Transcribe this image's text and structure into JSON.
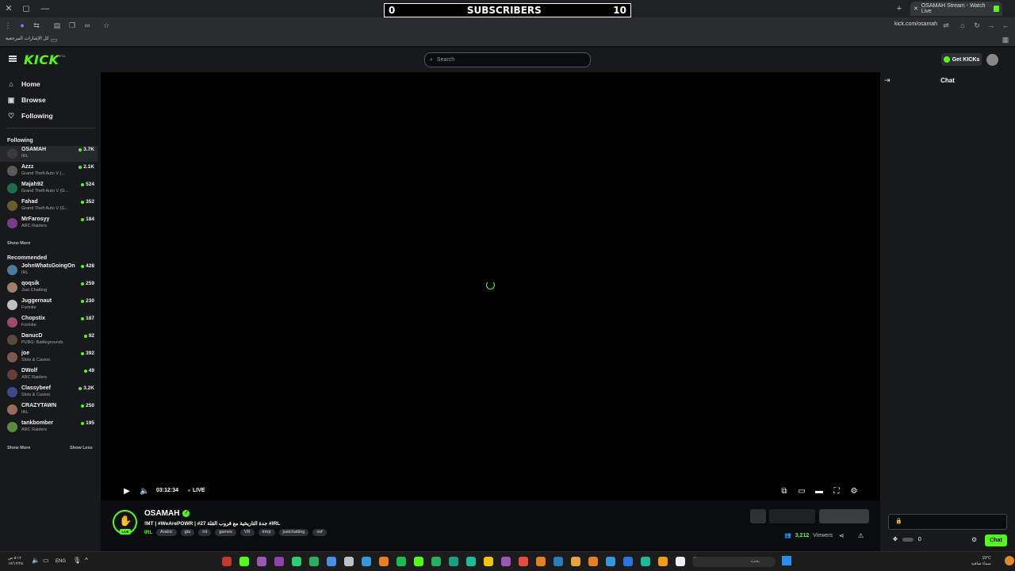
{
  "overlay": {
    "left_count": "0",
    "label": "SUBSCRIBERS",
    "right_count": "10"
  },
  "browser": {
    "tab_title": "OSAMAH Stream - Watch Live",
    "url": "kick.com/osamah",
    "bookmarks_label": "كل الإشارات المرجعية"
  },
  "header": {
    "logo": "KICK",
    "logo_beta": "BETA",
    "search_placeholder": "Search",
    "get_kicks": "Get KICKs"
  },
  "nav": [
    {
      "label": "Home",
      "icon": "home-icon"
    },
    {
      "label": "Browse",
      "icon": "compass-icon"
    },
    {
      "label": "Following",
      "icon": "heart-icon"
    }
  ],
  "following": {
    "title": "Following",
    "channels": [
      {
        "name": "OSAMAH",
        "category": "IRL",
        "viewers": "3.7K",
        "color": "#3a3a3a"
      },
      {
        "name": "Azzz",
        "category": "Grand Theft Auto V (...",
        "viewers": "2.1K",
        "color": "#5a5a5a"
      },
      {
        "name": "Majah92",
        "category": "Grand Theft Auto V (G...",
        "viewers": "524",
        "color": "#1f6b4a"
      },
      {
        "name": "Fahad",
        "category": "Grand Theft Auto V (G...",
        "viewers": "352",
        "color": "#6b5a2a"
      },
      {
        "name": "MrFarosyy",
        "category": "ARC Raiders",
        "viewers": "184",
        "color": "#7a3a8a"
      }
    ],
    "show_more": "Show More"
  },
  "recommended": {
    "title": "Recommended",
    "channels": [
      {
        "name": "JohnWhatsGoingOn",
        "category": "IRL",
        "viewers": "428",
        "color": "#4a7aa0"
      },
      {
        "name": "qoqsik",
        "category": "Just Chatting",
        "viewers": "259",
        "color": "#a0806a"
      },
      {
        "name": "Juggernaut",
        "category": "Fortnite",
        "viewers": "230",
        "color": "#c0c0c0"
      },
      {
        "name": "Chopstix",
        "category": "Fortnite",
        "viewers": "187",
        "color": "#a04a6a"
      },
      {
        "name": "DanucD",
        "category": "PUBG: Battlegrounds",
        "viewers": "92",
        "color": "#5a4a3a"
      },
      {
        "name": "joe",
        "category": "Slots & Casino",
        "viewers": "392",
        "color": "#7a5a4a"
      },
      {
        "name": "DWolf",
        "category": "ARC Raiders",
        "viewers": "49",
        "color": "#6a3a3a"
      },
      {
        "name": "Classybeef",
        "category": "Slots & Casino",
        "viewers": "3.2K",
        "color": "#3a4a8a"
      },
      {
        "name": "CRAZYTAWN",
        "category": "IRL",
        "viewers": "250",
        "color": "#9a6a5a"
      },
      {
        "name": "tankbomber",
        "category": "ARC Raiders",
        "viewers": "195",
        "color": "#5a8a3a"
      }
    ],
    "show_more": "Show More",
    "show_less": "Show Less"
  },
  "player": {
    "time": "03:12:34",
    "live": "LIVE"
  },
  "stream": {
    "streamer": "OSAMAH",
    "live_badge": "LIVE",
    "title": "!MT | #WeArePOWR | #27 جدة التاريخية مع قروب القلة #IRL",
    "category": "IRL",
    "tags": [
      "Arabic",
      "gta",
      "mt",
      "games",
      "VR",
      "mtrp",
      "justchatting",
      "osf"
    ],
    "viewers_label": "Viewers",
    "viewers_count": "3,212"
  },
  "chat": {
    "title": "Chat",
    "send": "Chat",
    "kicks": "0"
  },
  "taskbar": {
    "search": "بحث",
    "lang": "ENG",
    "time": "٥:١٢ ص",
    "date": "١٧/١٢/٢٥",
    "weather_temp": "19°C",
    "weather_desc": "سماء صافية"
  }
}
